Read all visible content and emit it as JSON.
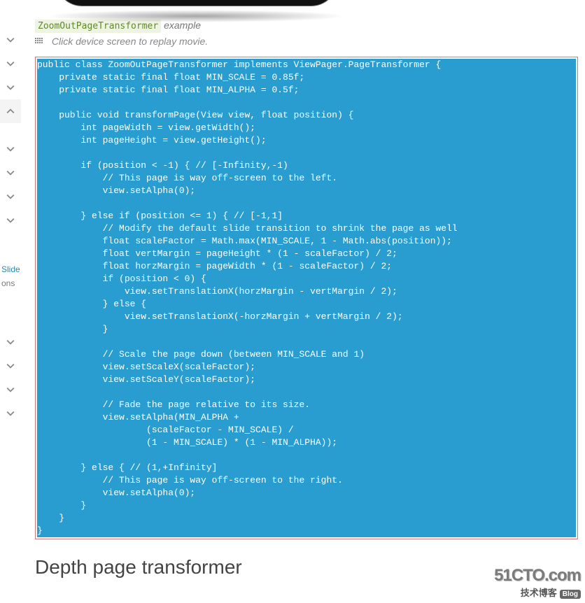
{
  "sidebar": {
    "labels": [
      "Slide",
      "ons"
    ]
  },
  "caption": {
    "badge": "ZoomOutPageTransformer",
    "suffix": "example"
  },
  "note": {
    "text": "Click device screen to replay movie."
  },
  "code": "public class ZoomOutPageTransformer implements ViewPager.PageTransformer {\n    private static final float MIN_SCALE = 0.85f;\n    private static final float MIN_ALPHA = 0.5f;\n\n    public void transformPage(View view, float position) {\n        int pageWidth = view.getWidth();\n        int pageHeight = view.getHeight();\n\n        if (position < -1) { // [-Infinity,-1)\n            // This page is way off-screen to the left.\n            view.setAlpha(0);\n\n        } else if (position <= 1) { // [-1,1]\n            // Modify the default slide transition to shrink the page as well\n            float scaleFactor = Math.max(MIN_SCALE, 1 - Math.abs(position));\n            float vertMargin = pageHeight * (1 - scaleFactor) / 2;\n            float horzMargin = pageWidth * (1 - scaleFactor) / 2;\n            if (position < 0) {\n                view.setTranslationX(horzMargin - vertMargin / 2);\n            } else {\n                view.setTranslationX(-horzMargin + vertMargin / 2);\n            }\n\n            // Scale the page down (between MIN_SCALE and 1)\n            view.setScaleX(scaleFactor);\n            view.setScaleY(scaleFactor);\n\n            // Fade the page relative to its size.\n            view.setAlpha(MIN_ALPHA +\n                    (scaleFactor - MIN_SCALE) /\n                    (1 - MIN_SCALE) * (1 - MIN_ALPHA));\n\n        } else { // (1,+Infinity]\n            // This page is way off-screen to the right.\n            view.setAlpha(0);\n        }\n    }\n}",
  "heading": "Depth page transformer",
  "watermark": {
    "line1a": "51CTO",
    "line1b": ".com",
    "line2": "技术博客",
    "pill": "Blog"
  }
}
